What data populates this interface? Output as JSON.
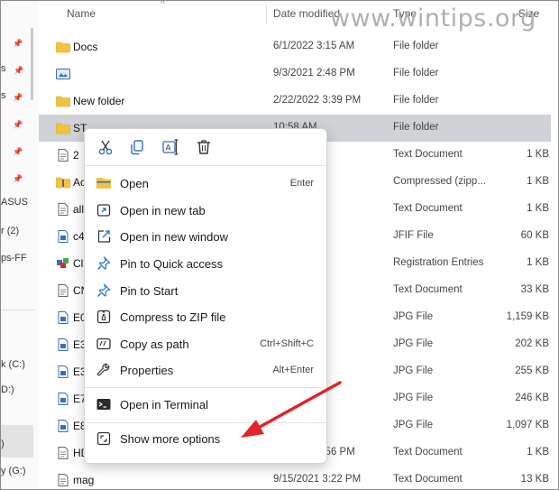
{
  "watermark": "www.wintips.org",
  "header": {
    "name": "Name",
    "date_modified": "Date modified",
    "type": "Type",
    "size": "Size"
  },
  "nav": {
    "labels": [
      "s",
      "s",
      "ASUS",
      "r (2)",
      "ps-FF",
      "k (C:)",
      "D:)",
      ")",
      "y (G:)"
    ]
  },
  "rows": [
    {
      "icon": "folder-icon",
      "name": "Docs",
      "date": "6/1/2022 3:15 AM",
      "type": "File folder",
      "size": ""
    },
    {
      "icon": "image-folder-icon",
      "name": "",
      "date": "9/3/2021 2:48 PM",
      "type": "File folder",
      "size": ""
    },
    {
      "icon": "folder-icon",
      "name": "New folder",
      "date": "2/22/2022 3:39 PM",
      "type": "File folder",
      "size": ""
    },
    {
      "icon": "folder-icon",
      "name": "ST",
      "date": "10:58 AM",
      "type": "File folder",
      "size": "",
      "selected": true
    },
    {
      "icon": "text-file-icon",
      "name": "2",
      "date": "12:22 AM",
      "type": "Text Document",
      "size": "1 KB"
    },
    {
      "icon": "zip-folder-icon",
      "name": "Ac",
      "date": ":51 AM",
      "type": "Compressed (zipp...",
      "size": "1 KB"
    },
    {
      "icon": "text-file-icon",
      "name": "all",
      "date": ":33 PM",
      "type": "Text Document",
      "size": "1 KB"
    },
    {
      "icon": "image-file-icon",
      "name": "c4",
      "date": "1:15 AM",
      "type": "JFIF File",
      "size": "60 KB"
    },
    {
      "icon": "registry-file-icon",
      "name": "Cl",
      "date": "5:32 PM",
      "type": "Registration Entries",
      "size": "1 KB"
    },
    {
      "icon": "text-file-icon",
      "name": "CN",
      "date": ":37 PM",
      "type": "Text Document",
      "size": "33 KB"
    },
    {
      "icon": "image-file-icon",
      "name": "E0",
      "date": ":02 AM",
      "type": "JPG File",
      "size": "1,159 KB"
    },
    {
      "icon": "image-file-icon",
      "name": "E3",
      "date": ":00 AM",
      "type": "JPG File",
      "size": "202 KB"
    },
    {
      "icon": "image-file-icon",
      "name": "E3",
      "date": ":00 AM",
      "type": "JPG File",
      "size": "255 KB"
    },
    {
      "icon": "image-file-icon",
      "name": "E7",
      "date": "1:29 AM",
      "type": "JPG File",
      "size": "246 KB"
    },
    {
      "icon": "image-file-icon",
      "name": "E8",
      "date": "2:58 AM",
      "type": "JPG File",
      "size": "1,097 KB"
    },
    {
      "icon": "text-file-icon",
      "name": "HDFC",
      "date": "3/2/2023 9:56 PM",
      "type": "Text Document",
      "size": "1 KB"
    },
    {
      "icon": "text-file-icon",
      "name": "mag",
      "date": "9/15/2021 3:22 PM",
      "type": "Text Document",
      "size": "13 KB"
    }
  ],
  "context_menu": {
    "toolbar": [
      "cut-icon",
      "copy-icon",
      "rename-icon",
      "delete-icon"
    ],
    "items": [
      {
        "icon": "folder-icon",
        "label": "Open",
        "shortcut": "Enter"
      },
      {
        "icon": "new-tab-icon",
        "label": "Open in new tab",
        "shortcut": ""
      },
      {
        "icon": "new-window-icon",
        "label": "Open in new window",
        "shortcut": ""
      },
      {
        "icon": "pin-icon",
        "label": "Pin to Quick access",
        "shortcut": ""
      },
      {
        "icon": "pin-icon",
        "label": "Pin to Start",
        "shortcut": ""
      },
      {
        "icon": "zip-icon",
        "label": "Compress to ZIP file",
        "shortcut": ""
      },
      {
        "icon": "copy-path-icon",
        "label": "Copy as path",
        "shortcut": "Ctrl+Shift+C"
      },
      {
        "icon": "wrench-icon",
        "label": "Properties",
        "shortcut": "Alt+Enter"
      },
      {
        "icon": "terminal-icon",
        "label": "Open in Terminal",
        "shortcut": ""
      },
      {
        "icon": "more-options-icon",
        "label": "Show more options",
        "shortcut": ""
      }
    ]
  },
  "colors": {
    "folder": "#f4c23c",
    "selected_row": "#cfd2d6",
    "arrow": "#e0242a",
    "accent": "#1f6fd1"
  }
}
